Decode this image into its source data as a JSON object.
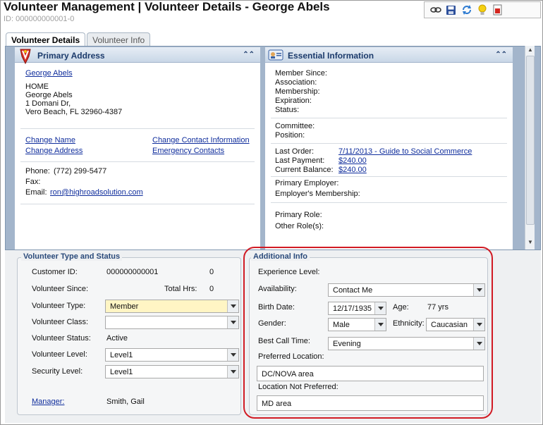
{
  "page": {
    "title": "Volunteer Management  |  Volunteer Details - George Abels",
    "id_line": "ID: 000000000001-0"
  },
  "toolbar": {
    "icons": [
      "view-icon",
      "save-icon",
      "refresh-icon",
      "lightbulb-icon",
      "report-icon"
    ]
  },
  "tabs": [
    {
      "label": "Volunteer Details",
      "active": true
    },
    {
      "label": "Volunteer Info",
      "active": false
    }
  ],
  "primary_address": {
    "header": "Primary Address",
    "name_link": "George Abels",
    "address_type": "HOME",
    "address_lines": [
      "George Abels",
      "1 Domani Dr,",
      "Vero Beach, FL 32960-4387"
    ],
    "links": {
      "change_name": "Change Name",
      "change_contact": "Change Contact Information",
      "change_address": "Change Address",
      "emergency_contacts": "Emergency Contacts"
    },
    "phone_label": "Phone:",
    "phone_value": "(772) 299-5477",
    "fax_label": "Fax:",
    "email_label": "Email:",
    "email_value": "ron@highroadsolution.com"
  },
  "essential_info": {
    "header": "Essential Information",
    "labels": {
      "member_since": "Member Since:",
      "association": "Association:",
      "membership": "Membership:",
      "expiration": "Expiration:",
      "status": "Status:",
      "committee": "Committee:",
      "position": "Position:",
      "last_order": "Last Order:",
      "last_payment": "Last Payment:",
      "current_balance": "Current Balance:",
      "primary_employer": "Primary Employer:",
      "employers_membership": "Employer's Membership:",
      "primary_role": "Primary Role:",
      "other_roles": "Other Role(s):"
    },
    "last_order_value": "7/11/2013 - Guide to Social Commerce",
    "last_payment_value": "$240.00",
    "current_balance_value": "$240.00"
  },
  "volunteer_type_status": {
    "legend": "Volunteer Type and Status",
    "customer_id_label": "Customer ID:",
    "customer_id_value": "000000000001",
    "customer_id_extra": "0",
    "volunteer_since_label": "Volunteer Since:",
    "total_hrs_label": "Total Hrs:",
    "total_hrs_value": "0",
    "volunteer_type_label": "Volunteer Type:",
    "volunteer_type_value": "Member",
    "volunteer_class_label": "Volunteer Class:",
    "volunteer_class_value": "",
    "volunteer_status_label": "Volunteer Status:",
    "volunteer_status_value": "Active",
    "volunteer_level_label": "Volunteer Level:",
    "volunteer_level_value": "Level1",
    "security_level_label": "Security Level:",
    "security_level_value": "Level1",
    "manager_label": "Manager:",
    "manager_value": "Smith, Gail"
  },
  "additional_info": {
    "legend": "Additional Info",
    "experience_level_label": "Experience Level:",
    "availability_label": "Availability:",
    "availability_value": "Contact Me",
    "birth_date_label": "Birth Date:",
    "birth_date_value": "12/17/1935",
    "age_label": "Age:",
    "age_value": "77 yrs",
    "gender_label": "Gender:",
    "gender_value": "Male",
    "ethnicity_label": "Ethnicity:",
    "ethnicity_value": "Caucasian",
    "best_call_time_label": "Best Call Time:",
    "best_call_time_value": "Evening",
    "preferred_location_label": "Preferred Location:",
    "preferred_location_value": "DC/NOVA area",
    "location_not_preferred_label": "Location Not Preferred:",
    "location_not_preferred_value": "MD area"
  }
}
